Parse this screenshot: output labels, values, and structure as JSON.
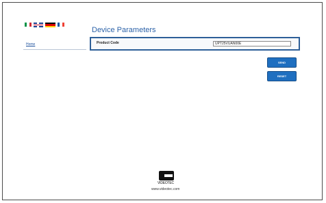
{
  "languages": [
    {
      "name": "italian-flag",
      "colors": [
        "#009246",
        "#ffffff",
        "#ce2b37"
      ]
    },
    {
      "name": "uk-flag",
      "colors": [
        "#1a3a8c",
        "#ffffff",
        "#c8102e"
      ]
    },
    {
      "name": "german-flag",
      "colors": [
        "#000000",
        "#dd0000",
        "#ffce00"
      ]
    },
    {
      "name": "french-flag",
      "colors": [
        "#0055a4",
        "#ffffff",
        "#ef4135"
      ]
    }
  ],
  "nav": {
    "home_label": "Home"
  },
  "page": {
    "title": "Device Parameters"
  },
  "form": {
    "product_code_label": "Product Code",
    "product_code_value": "UPT25VUAN00E"
  },
  "buttons": {
    "send_label": "SEND",
    "reset_label": "RESET"
  },
  "footer": {
    "brand_text": "VIDEOTEC",
    "url": "www.videotec.com"
  },
  "colors": {
    "accent": "#2c62a8",
    "button": "#1f6fc0",
    "box_border": "#2d5f98"
  }
}
